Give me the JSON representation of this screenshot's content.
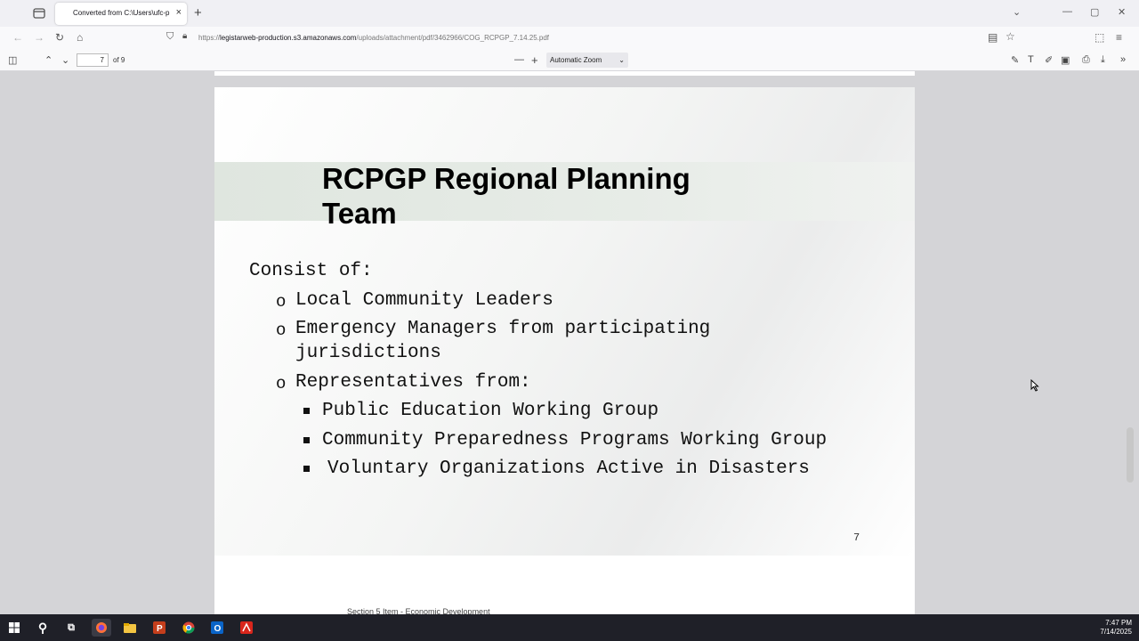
{
  "browser": {
    "tab_title": "Converted from C:\\Users\\ufc-p",
    "tab_close": "×",
    "new_tab": "+",
    "url_prefix": "https://",
    "url_host": "legistarweb-production.s3.amazonaws.com",
    "url_path": "/uploads/attachment/pdf/3462966/COG_RCPGP_7.14.25.pdf"
  },
  "pdf_toolbar": {
    "page_number": "7",
    "page_of": "of 9",
    "zoom": "Automatic Zoom"
  },
  "slide": {
    "title": "RCPGP Regional Planning Team",
    "heading": "Consist of:",
    "items": [
      "Local Community Leaders",
      "Emergency Managers from participating",
      "jurisdictions",
      "Representatives from:"
    ],
    "sub_items": [
      "Public Education Working Group",
      "Community Preparedness Programs Working Group",
      "Voluntary Organizations Active in Disasters"
    ],
    "bullet_marker": "o",
    "page_number": "7"
  },
  "next_page_snippet": "Section 5 Item - Economic Development",
  "taskbar": {
    "time": "7:47 PM",
    "date": "7/14/2025"
  }
}
